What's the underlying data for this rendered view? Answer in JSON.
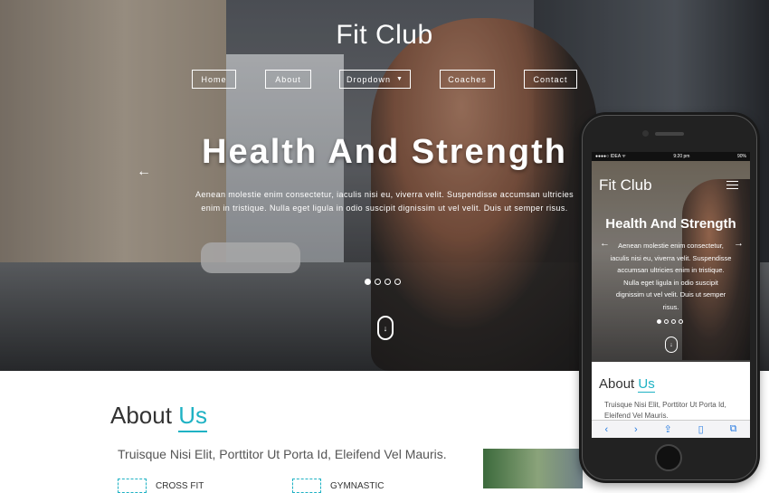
{
  "site": {
    "brand": "Fit Club"
  },
  "nav": {
    "items": [
      "Home",
      "About",
      "Dropdown",
      "Coaches",
      "Contact"
    ]
  },
  "hero": {
    "headline": "Health And Strength",
    "lede": "Aenean molestie enim consectetur, iaculis nisi eu, viverra velit. Suspendisse accumsan ultricies enim in tristique. Nulla eget ligula in odio suscipit dignissim ut vel velit. Duis ut semper risus.",
    "slide_count": 4,
    "active_slide": 1
  },
  "about": {
    "title_plain": "About",
    "title_accent": "Us",
    "subtitle": "Truisque Nisi Elit, Porttitor Ut Porta Id, Eleifend Vel Mauris.",
    "features": [
      "CROSS FIT",
      "GYMNASTIC"
    ]
  },
  "mobile": {
    "status_left": "●●●●○ IDEA ᯤ",
    "status_time": "9:20 pm",
    "status_right": "90%",
    "brand": "Fit Club",
    "headline": "Health And Strength",
    "lede": "Aenean molestie enim consectetur, iaculis nisi eu, viverra velit. Suspendisse accumsan ultricies enim in tristique. Nulla eget ligula in odio suscipit dignissim ut vel velit. Duis ut semper risus.",
    "about_plain": "About",
    "about_accent": "Us",
    "about_sub": "Truisque Nisi Elit, Porttitor Ut Porta Id, Eleifend Vel Mauris."
  },
  "colors": {
    "accent": "#1fb2c4",
    "ios_blue": "#2a7de1"
  },
  "icons": {
    "prev": "arrow-left-icon",
    "next": "arrow-right-icon",
    "scroll": "scroll-down-icon",
    "menu": "hamburger-menu-icon"
  }
}
